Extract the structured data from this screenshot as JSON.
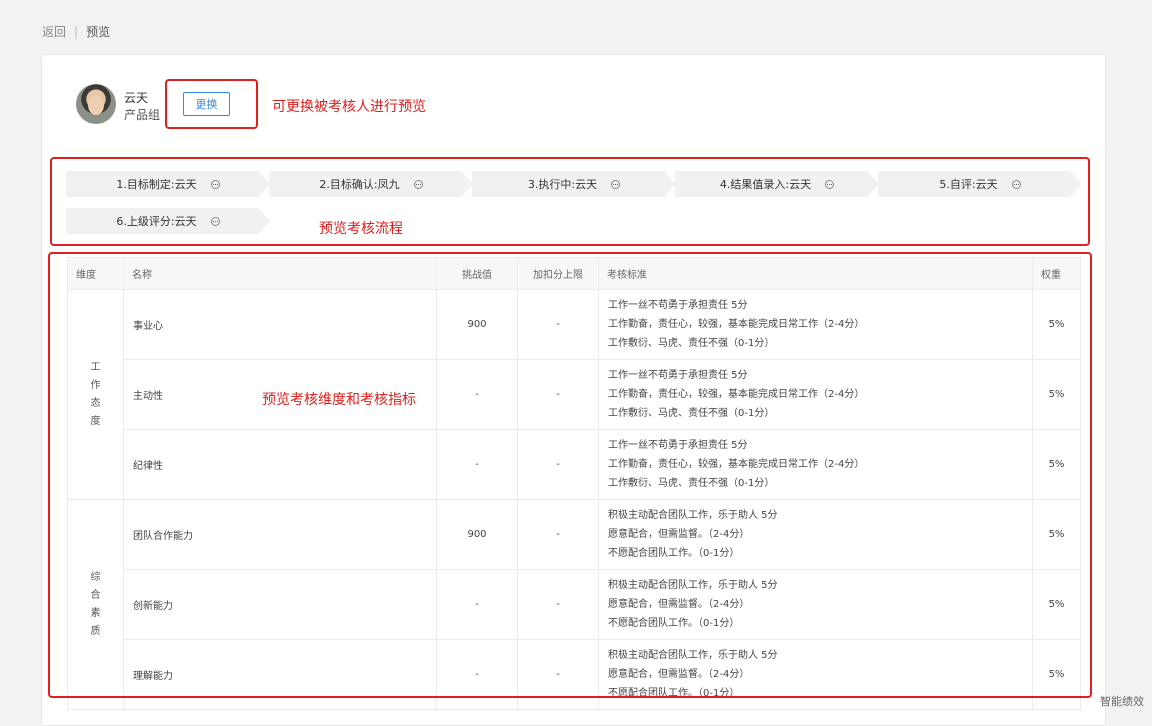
{
  "breadcrumb": {
    "back": "返回",
    "current": "预览"
  },
  "user": {
    "name": "云天",
    "group": "产品组",
    "change_label": "更换"
  },
  "notes": {
    "user": "可更换被考核人进行预览",
    "flow": "预览考核流程",
    "table": "预览考核维度和考核指标"
  },
  "flow": {
    "steps": [
      "1.目标制定:云天",
      "2.目标确认:凤九",
      "3.执行中:云天",
      "4.结果值录入:云天",
      "5.自评:云天",
      "6.上级评分:云天"
    ]
  },
  "table": {
    "headers": [
      "维度",
      "名称",
      "挑战值",
      "加扣分上限",
      "考核标准",
      "权重"
    ],
    "groups": [
      {
        "dimension": "工作态度",
        "rows": [
          {
            "name": "事业心",
            "challenge": "900",
            "limit": "-",
            "weight": "5%",
            "standard": [
              "工作一丝不苟勇于承担责任 5分",
              "工作勤奋，责任心，较强，基本能完成日常工作（2-4分）",
              "工作敷衍、马虎、责任不强（0-1分）"
            ]
          },
          {
            "name": "主动性",
            "challenge": "-",
            "limit": "-",
            "weight": "5%",
            "standard": [
              "工作一丝不苟勇于承担责任 5分",
              "工作勤奋，责任心，较强，基本能完成日常工作（2-4分）",
              "工作敷衍、马虎、责任不强（0-1分）"
            ]
          },
          {
            "name": "纪律性",
            "challenge": "-",
            "limit": "-",
            "weight": "5%",
            "standard": [
              "工作一丝不苟勇于承担责任 5分",
              "工作勤奋，责任心，较强，基本能完成日常工作（2-4分）",
              "工作敷衍、马虎、责任不强（0-1分）"
            ]
          }
        ]
      },
      {
        "dimension": "综合素质",
        "rows": [
          {
            "name": "团队合作能力",
            "challenge": "900",
            "limit": "-",
            "weight": "5%",
            "standard": [
              "积极主动配合团队工作，乐于助人 5分",
              "愿意配合，但需监督。（2-4分）",
              "不愿配合团队工作。（0-1分）"
            ]
          },
          {
            "name": "创新能力",
            "challenge": "-",
            "limit": "-",
            "weight": "5%",
            "standard": [
              "积极主动配合团队工作，乐于助人 5分",
              "愿意配合，但需监督。（2-4分）",
              "不愿配合团队工作。（0-1分）"
            ]
          },
          {
            "name": "理解能力",
            "challenge": "-",
            "limit": "-",
            "weight": "5%",
            "standard": [
              "积极主动配合团队工作，乐于助人 5分",
              "愿意配合，但需监督。（2-4分）",
              "不愿配合团队工作。（0-1分）"
            ]
          }
        ]
      }
    ]
  },
  "watermark": "智能绩效",
  "colors": {
    "accent": "#2d8cf0",
    "annotation": "#e02020"
  }
}
